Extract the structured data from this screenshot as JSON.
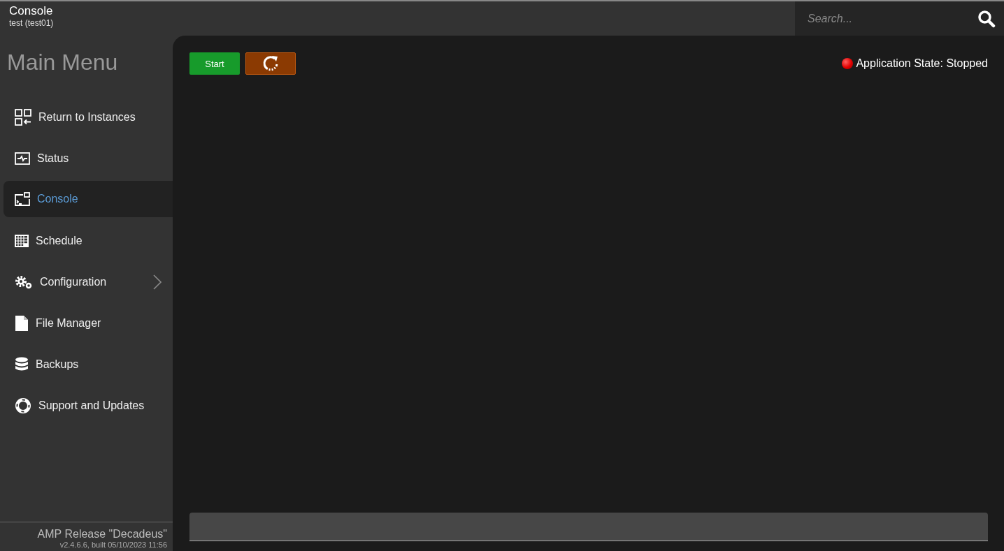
{
  "header": {
    "title": "Console",
    "subtitle": "test (test01)"
  },
  "search": {
    "placeholder": "Search..."
  },
  "sidebar": {
    "heading": "Main Menu",
    "items": [
      {
        "kind": "instances",
        "label": "Return to Instances",
        "selected": false
      },
      {
        "kind": "status",
        "label": "Status",
        "selected": false
      },
      {
        "kind": "console",
        "label": "Console",
        "selected": true
      },
      {
        "kind": "schedule",
        "label": "Schedule",
        "selected": false
      },
      {
        "kind": "configuration",
        "label": "Configuration",
        "selected": false,
        "has_submenu": true
      },
      {
        "kind": "files",
        "label": "File Manager",
        "selected": false
      },
      {
        "kind": "backups",
        "label": "Backups",
        "selected": false
      },
      {
        "kind": "support",
        "label": "Support and Updates",
        "selected": false
      }
    ],
    "footer": {
      "release": "AMP Release \"Decadeus\"",
      "build": "v2.4.6.6, built 05/10/2023 11:56"
    }
  },
  "toolbar": {
    "start_button": "Start",
    "app_state": "Application State: Stopped"
  }
}
